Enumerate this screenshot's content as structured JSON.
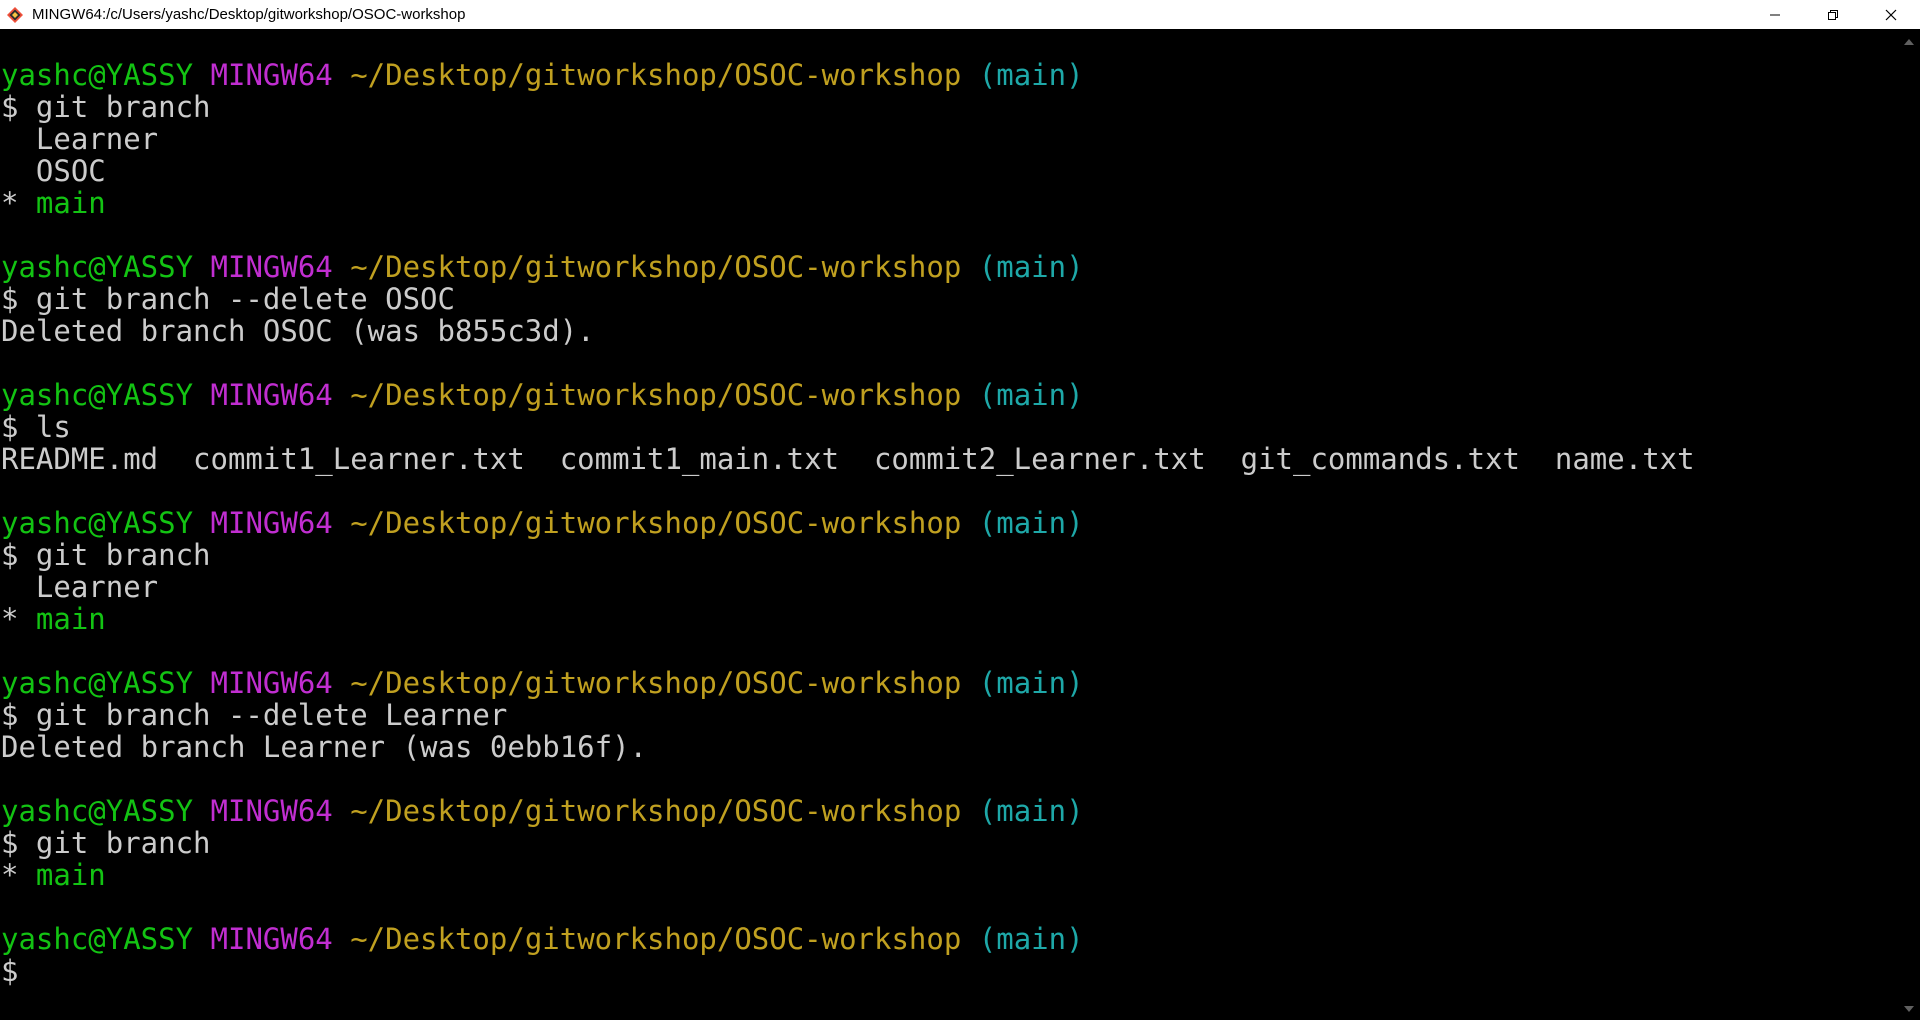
{
  "window": {
    "title": "MINGW64:/c/Users/yashc/Desktop/gitworkshop/OSOC-workshop",
    "icons": {
      "app": "git-bash-icon",
      "minimize": "minimize-icon",
      "maximize": "restore-icon",
      "close": "close-icon"
    }
  },
  "colors": {
    "background": "#000000",
    "user_host": "#13c313",
    "system": "#c12ed1",
    "path": "#c0a020",
    "branch": "#1ea8a8",
    "text": "#cccccc"
  },
  "prompt": {
    "user_host": "yashc@YASSY",
    "system": "MINGW64",
    "path": "~/Desktop/gitworkshop/OSOC-workshop",
    "branch": "(main)"
  },
  "terminal": {
    "lines": [
      {
        "type": "prompt"
      },
      {
        "type": "text",
        "text": "$ git branch"
      },
      {
        "type": "text",
        "text": "  Learner"
      },
      {
        "type": "text",
        "text": "  OSOC"
      },
      {
        "type": "current_branch",
        "marker": "* ",
        "text": "main"
      },
      {
        "type": "blank"
      },
      {
        "type": "prompt"
      },
      {
        "type": "text",
        "text": "$ git branch --delete OSOC"
      },
      {
        "type": "text",
        "text": "Deleted branch OSOC (was b855c3d)."
      },
      {
        "type": "blank"
      },
      {
        "type": "prompt"
      },
      {
        "type": "text",
        "text": "$ ls"
      },
      {
        "type": "text",
        "text": "README.md  commit1_Learner.txt  commit1_main.txt  commit2_Learner.txt  git_commands.txt  name.txt"
      },
      {
        "type": "blank"
      },
      {
        "type": "prompt"
      },
      {
        "type": "text",
        "text": "$ git branch"
      },
      {
        "type": "text",
        "text": "  Learner"
      },
      {
        "type": "current_branch",
        "marker": "* ",
        "text": "main"
      },
      {
        "type": "blank"
      },
      {
        "type": "prompt"
      },
      {
        "type": "text",
        "text": "$ git branch --delete Learner"
      },
      {
        "type": "text",
        "text": "Deleted branch Learner (was 0ebb16f)."
      },
      {
        "type": "blank"
      },
      {
        "type": "prompt"
      },
      {
        "type": "text",
        "text": "$ git branch"
      },
      {
        "type": "current_branch",
        "marker": "* ",
        "text": "main"
      },
      {
        "type": "blank"
      },
      {
        "type": "prompt"
      },
      {
        "type": "text",
        "text": "$"
      }
    ]
  }
}
